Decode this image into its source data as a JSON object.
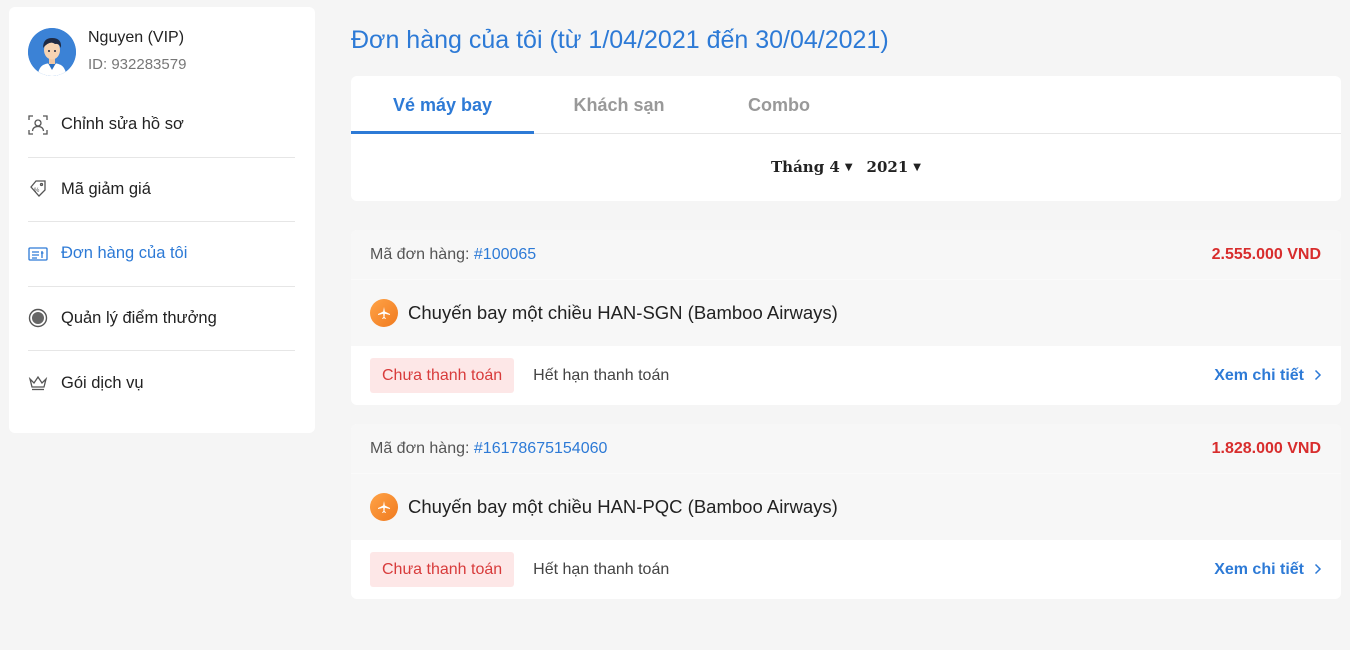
{
  "profile": {
    "name": "Nguyen (VIP)",
    "id_text": "ID: 932283579"
  },
  "sidebar": {
    "items": [
      {
        "label": "Chỉnh sửa hồ sơ",
        "icon": "profile-scan-icon",
        "active": false
      },
      {
        "label": "Mã giảm giá",
        "icon": "discount-tag-icon",
        "active": false
      },
      {
        "label": "Đơn hàng của tôi",
        "icon": "order-list-icon",
        "active": true
      },
      {
        "label": "Quản lý điểm thưởng",
        "icon": "points-circle-icon",
        "active": false
      },
      {
        "label": "Gói dịch vụ",
        "icon": "crown-icon",
        "active": false
      }
    ]
  },
  "main": {
    "title": "Đơn hàng của tôi (từ 1/04/2021 đến 30/04/2021)",
    "tabs": [
      {
        "label": "Vé máy bay",
        "active": true
      },
      {
        "label": "Khách sạn",
        "active": false
      },
      {
        "label": "Combo",
        "active": false
      }
    ],
    "filters": {
      "month": "Tháng 4",
      "year": "2021"
    }
  },
  "orders": [
    {
      "code_label": "Mã đơn hàng:",
      "code": "#100065",
      "price": "2.555.000 VND",
      "title": "Chuyến bay một chiều HAN-SGN (Bamboo Airways)",
      "status_badge": "Chưa thanh toán",
      "status_text": "Hết hạn thanh toán",
      "detail_label": "Xem chi tiết"
    },
    {
      "code_label": "Mã đơn hàng:",
      "code": "#16178675154060",
      "price": "1.828.000 VND",
      "title": "Chuyến bay một chiều HAN-PQC (Bamboo Airways)",
      "status_badge": "Chưa thanh toán",
      "status_text": "Hết hạn thanh toán",
      "detail_label": "Xem chi tiết"
    }
  ],
  "colors": {
    "accent": "#2d7ad6",
    "price": "#d82d2d",
    "badge_bg": "#fde7e7",
    "badge_text": "#d83b3b",
    "plane_badge": "#f5892b"
  }
}
